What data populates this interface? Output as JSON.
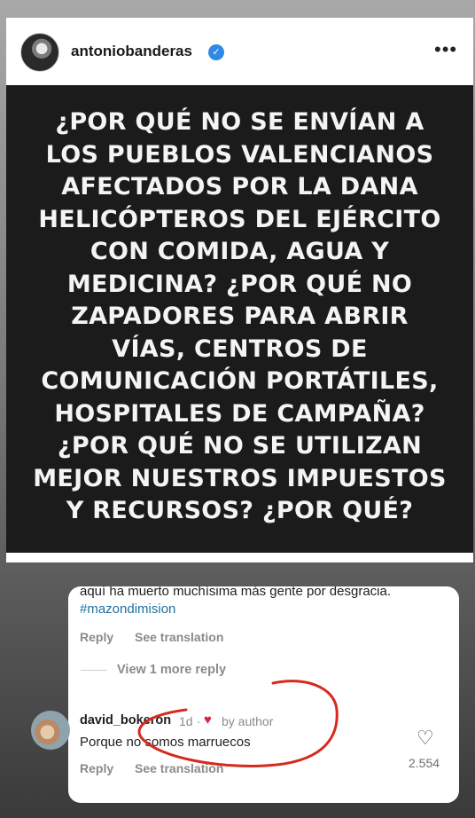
{
  "post": {
    "username": "antoniobanderas",
    "verified_icon": "verified-badge-icon",
    "more_label": "•••",
    "image_text": "¿Por qué no se envían a los pueblos valencianos afectados por la DANA helicópteros del Ejército con comida, agua y medicina? ¿Por qué no zapadores para abrir vías, centros de comunicación portátiles, hospitales de campaña? ¿Por qué no se utilizan mejor nuestros impuestos y recursos? ¿Por qué?"
  },
  "comments": {
    "previous_comment_text": "aquí ha muerto muchísima más gente por desgracia.",
    "previous_comment_hashtag": "#mazondimision",
    "reply_label": "Reply",
    "see_translation_label": "See translation",
    "view_more_replies": "View 1 more reply",
    "reply": {
      "username": "david_bokeron",
      "time": "1d ·",
      "by_author": "by author",
      "text": "Porque no somos marruecos",
      "like_count": "2.554",
      "reply_label": "Reply",
      "see_translation_label": "See translation"
    }
  },
  "colors": {
    "annotation_stroke": "#d62a1e",
    "hashtag": "#1f6f9f",
    "verified": "#2f8ae6",
    "heart": "#e0223a"
  }
}
